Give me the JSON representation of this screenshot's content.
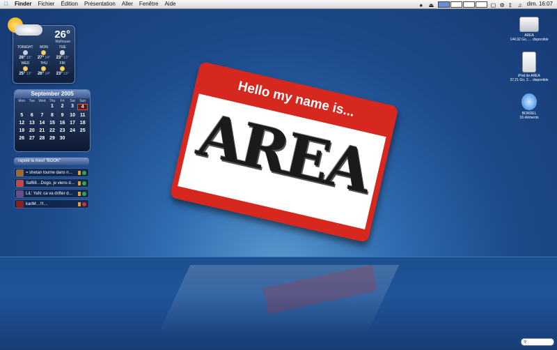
{
  "menubar": {
    "apple_icon": "apple-icon",
    "app": "Finder",
    "items": [
      "Fichier",
      "Édition",
      "Présentation",
      "Aller",
      "Fenêtre",
      "Aide"
    ],
    "clock": "dim. 16:07"
  },
  "weather": {
    "current_temp": "26°",
    "city": "Mulhouse",
    "days": [
      {
        "label": "TONIGHT",
        "icon": "moon-icon",
        "hi": "26°",
        "lo": "13°"
      },
      {
        "label": "MON",
        "icon": "sun-icon",
        "hi": "27°",
        "lo": "14°"
      },
      {
        "label": "TUE",
        "icon": "rain-icon",
        "hi": "23°",
        "lo": "13°"
      },
      {
        "label": "WED",
        "icon": "sun-icon",
        "hi": "25°",
        "lo": "13°"
      },
      {
        "label": "THU",
        "icon": "sun-icon",
        "hi": "26°",
        "lo": "14°"
      },
      {
        "label": "FRI",
        "icon": "sun-icon",
        "hi": "23°",
        "lo": "13°"
      }
    ]
  },
  "calendar": {
    "title": "September 2005",
    "weekdays": [
      "Mon",
      "Tue",
      "Wed",
      "Thu",
      "Fri",
      "Sat",
      "Sun"
    ],
    "days": [
      "",
      "",
      "",
      "1",
      "2",
      "3",
      "4",
      "5",
      "6",
      "7",
      "8",
      "9",
      "10",
      "11",
      "12",
      "13",
      "14",
      "15",
      "16",
      "17",
      "18",
      "19",
      "20",
      "21",
      "22",
      "23",
      "24",
      "25",
      "26",
      "27",
      "28",
      "29",
      "30",
      "",
      ""
    ],
    "today": "4"
  },
  "buddies": {
    "header": "rapelé la meuf \"BOOK\"",
    "items": [
      {
        "text": "= shetan tourne dans n…",
        "avatar_color": "#9a6b3a",
        "status_color": "#3fa33f"
      },
      {
        "text": "Saf68…Dogo, je viens d…",
        "avatar_color": "#c24848",
        "status_color": "#3fa33f"
      },
      {
        "text": "LiL' YaN: ca va drifter d…",
        "avatar_color": "#6b4c8a",
        "status_color": "#3fa33f"
      },
      {
        "text": "kariM…!!!…",
        "avatar_color": "#8a2020",
        "status_color": "#d83030"
      }
    ]
  },
  "nametag": {
    "title": "Hello my name is...",
    "graffiti": "AREA"
  },
  "desktop_icons": [
    {
      "name": "AREA",
      "info": "144,92 Go, … disponible",
      "kind": "hard-drive-icon"
    },
    {
      "name": "iPod de AREA",
      "info": "37,21 Go, 2… disponible",
      "kind": "ipod-icon"
    },
    {
      "name": "BORDEL",
      "info": "16 éléments",
      "kind": "folder-icon"
    }
  ]
}
